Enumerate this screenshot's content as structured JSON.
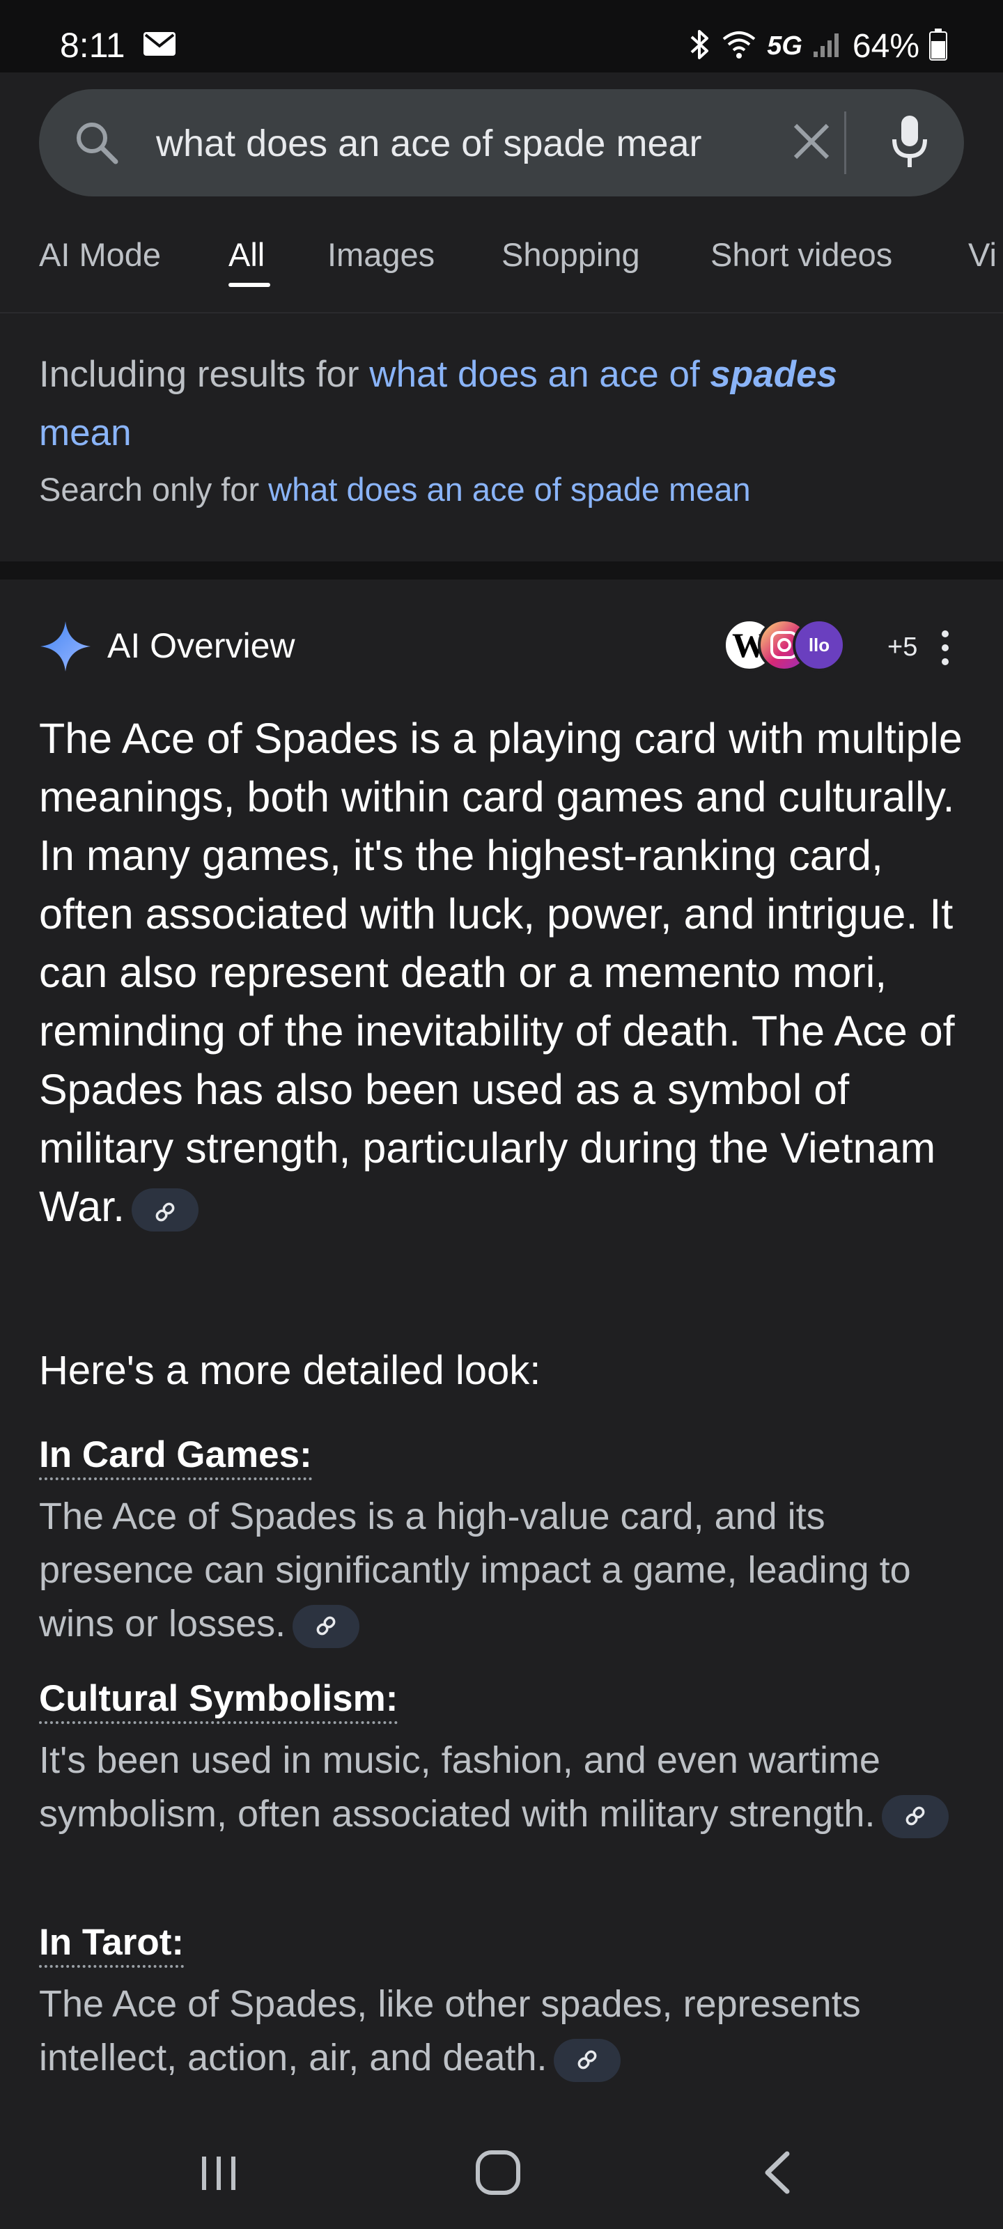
{
  "status_bar": {
    "time": "8:11",
    "network": "5G",
    "battery": "64%",
    "icons": [
      "mail-icon",
      "bluetooth-icon",
      "wifi-icon",
      "signal-icon",
      "battery-icon"
    ]
  },
  "search": {
    "query": "what does an ace of spade mear"
  },
  "tabs": [
    "AI Mode",
    "All",
    "Images",
    "Shopping",
    "Short videos",
    "Vi"
  ],
  "active_tab": "All",
  "correction": {
    "including_prefix": "Including results for ",
    "including_link_part1": "what does an ace of ",
    "including_link_bold": "spades",
    "including_link_part2": "mean",
    "search_only_prefix": "Search only for ",
    "search_only_link": "what does an ace of spade mean"
  },
  "ai_overview": {
    "title": "AI Overview",
    "source_letters": [
      "W",
      "llo"
    ],
    "more_sources": "+5",
    "summary": "The Ace of Spades is a playing card with multiple meanings, both within card games and culturally. In many games, it's the highest-ranking card, often associated with luck, power, and intrigue. It can also represent death or a memento mori, reminding of the inevitability of death. The Ace of Spades has also been used as a symbol of military strength, particularly during the Vietnam War.",
    "subheading": "Here's a more detailed look:",
    "details": [
      {
        "title": "In Card Games:",
        "body": "The Ace of Spades is a high-value card, and its presence can significantly impact a game, leading to wins or losses."
      },
      {
        "title": "Cultural Symbolism:",
        "body": "It's been used in music, fashion, and even wartime symbolism, often associated with military strength."
      },
      {
        "title": "In Tarot:",
        "body": "The Ace of Spades, like other spades, represents intellect, action, air, and death."
      }
    ]
  },
  "colors": {
    "background": "#1f1f21",
    "search_box": "#3c4043",
    "link": "#8ab4f8",
    "cite_chip": "#2c3340"
  }
}
